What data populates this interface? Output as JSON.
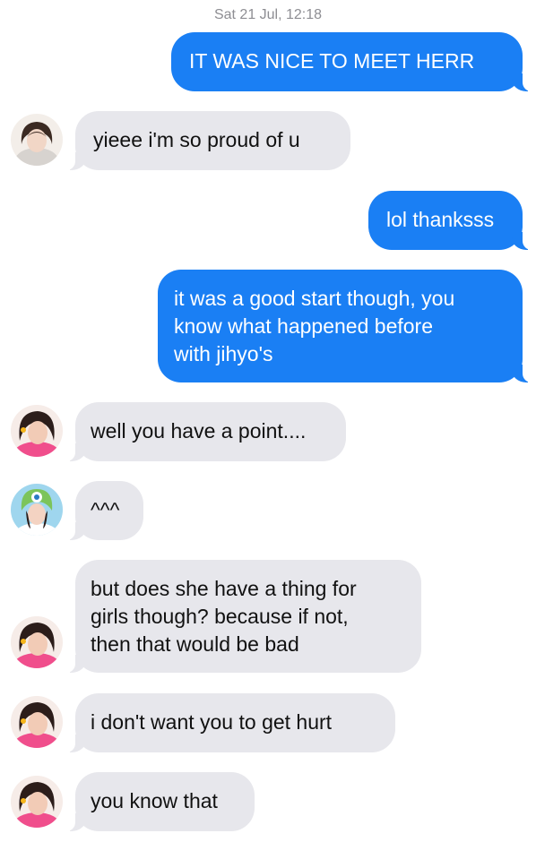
{
  "conversation": {
    "timestamp": "Sat 21 Jul, 12:18",
    "messages": [
      {
        "text": "IT WAS NICE TO MEET HERR"
      },
      {
        "text": "yieee i'm so proud of u"
      },
      {
        "text": "lol thanksss"
      },
      {
        "lines": [
          "it was a good start though, you",
          "know what happened before",
          "with jihyo's"
        ]
      },
      {
        "text": "well you have a point...."
      },
      {
        "text": "^^^"
      },
      {
        "lines": [
          "but does she have a thing for",
          "girls though? because if not,",
          "then that would be bad"
        ]
      },
      {
        "text": "i don't want you to get hurt"
      },
      {
        "text": "you know that"
      }
    ]
  },
  "colors": {
    "outgoing_bubble": "#1a7ff4",
    "incoming_bubble": "#e7e7ec",
    "timestamp_text": "#8e8e93"
  }
}
